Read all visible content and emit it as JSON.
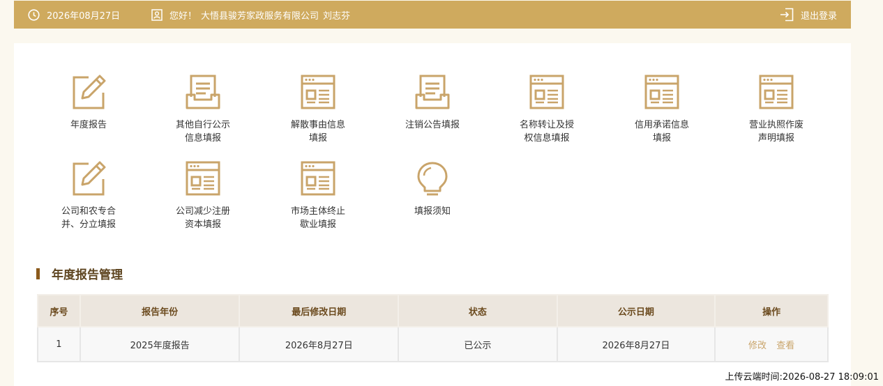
{
  "header": {
    "date": "2026年08月27日",
    "greeting": "您好！",
    "company": "大悟县骏芳家政服务有限公司",
    "user": "刘志芬",
    "logout": "退出登录"
  },
  "tiles": [
    {
      "label": "年度报告",
      "icon": "edit-icon"
    },
    {
      "label": "其他自行公示\n信息填报",
      "icon": "document-tray-icon"
    },
    {
      "label": "解散事由信息\n填报",
      "icon": "form-window-icon"
    },
    {
      "label": "注销公告填报",
      "icon": "document-tray-icon"
    },
    {
      "label": "名称转让及授\n权信息填报",
      "icon": "form-window-icon"
    },
    {
      "label": "信用承诺信息\n填报",
      "icon": "form-window-icon"
    },
    {
      "label": "营业执照作废\n声明填报",
      "icon": "form-window-icon"
    },
    {
      "label": "公司和农专合\n并、分立填报",
      "icon": "edit-icon"
    },
    {
      "label": "公司减少注册\n资本填报",
      "icon": "form-window-icon"
    },
    {
      "label": "市场主体终止\n歇业填报",
      "icon": "form-window-icon"
    },
    {
      "label": "填报须知",
      "icon": "lightbulb-icon"
    }
  ],
  "section": {
    "title": "年度报告管理"
  },
  "table": {
    "headers": [
      "序号",
      "报告年份",
      "最后修改日期",
      "状态",
      "公示日期",
      "操作"
    ],
    "rows": [
      {
        "no": "1",
        "year": "2025年度报告",
        "modified": "2026年8月27日",
        "status": "已公示",
        "published": "2026年8月27日",
        "edit": "修改",
        "view": "查看"
      }
    ]
  },
  "footer": {
    "upload_time": "上传云端时间:2026-08-27 18:09:01"
  },
  "colors": {
    "accent": "#cfaa5e",
    "icon": "#c9a46a",
    "section": "#8b5a1c"
  }
}
